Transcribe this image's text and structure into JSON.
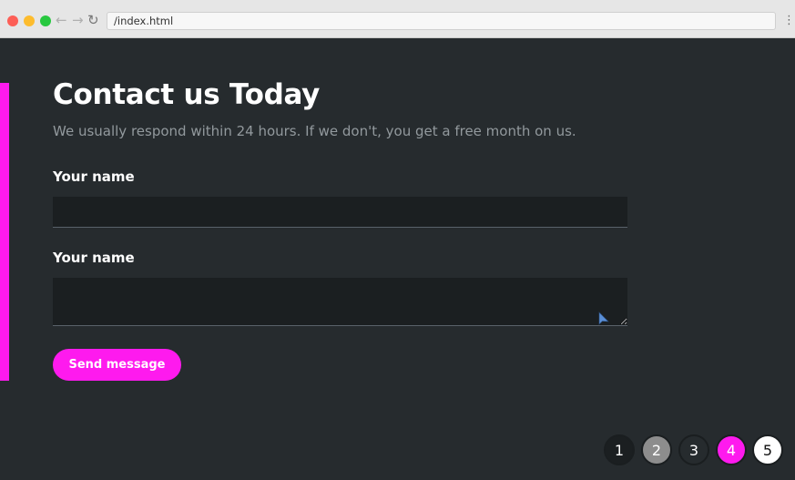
{
  "browser": {
    "address": "/index.html",
    "back_glyph": "←",
    "forward_glyph": "→",
    "reload_glyph": "↻",
    "menu_glyph": "⋮"
  },
  "page": {
    "title": "Contact us Today",
    "subtitle": "We usually respond within 24 hours. If we don't, you get a free month on us.",
    "accent_color": "#fe1aee",
    "background_color": "#262b2e"
  },
  "form": {
    "name_label": "Your name",
    "name_value": "",
    "message_label": "Your name",
    "message_value": "",
    "submit_label": "Send message"
  },
  "pager": {
    "pages": [
      "1",
      "2",
      "3",
      "4",
      "5"
    ],
    "active_page": "4"
  }
}
